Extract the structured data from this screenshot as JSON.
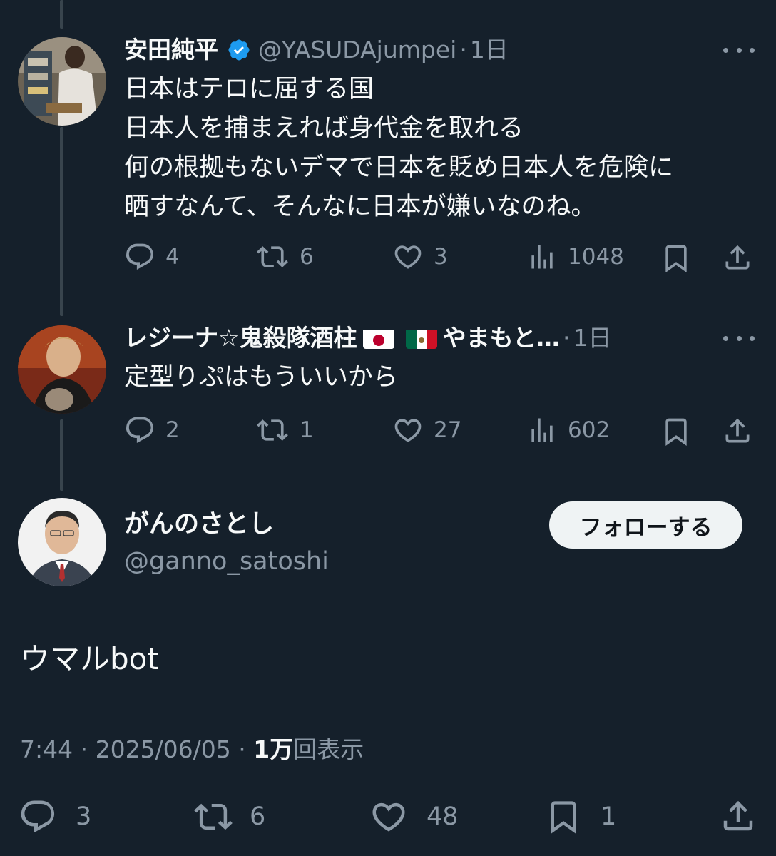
{
  "tweets": [
    {
      "display_name": "安田純平",
      "verified": true,
      "handle": "@YASUDAjumpei",
      "separator": "·",
      "time": "1日",
      "text": "日本はテロに屈する国\n日本人を捕まえれば身代金を取れる\n何の根拠もないデマで日本を貶め日本人を危険に\n晒すなんて、そんなに日本が嫌いなのね。",
      "replies": "4",
      "retweets": "6",
      "likes": "3",
      "views": "1048"
    },
    {
      "display_name": "レジーナ☆鬼殺隊酒柱",
      "display_name_suffix": "やまもと…",
      "flags": [
        "japan-flag",
        "mexico-flag"
      ],
      "separator": "·",
      "time": "1日",
      "text": "定型りぷはもういいから",
      "replies": "2",
      "retweets": "1",
      "likes": "27",
      "views": "602"
    }
  ],
  "main_tweet": {
    "display_name": "がんのさとし",
    "handle": "@ganno_satoshi",
    "follow_label": "フォローする",
    "text": "ウマルbot",
    "timestamp": "7:44 · 2025/06/05 · ",
    "views_count": "1万",
    "views_label": "回表示",
    "replies": "3",
    "retweets": "6",
    "likes": "48",
    "bookmarks": "1"
  },
  "colors": {
    "background": "#15202b",
    "secondary_text": "#8b98a5",
    "verified_blue": "#1d9bf0",
    "thread_line": "#38444d"
  }
}
